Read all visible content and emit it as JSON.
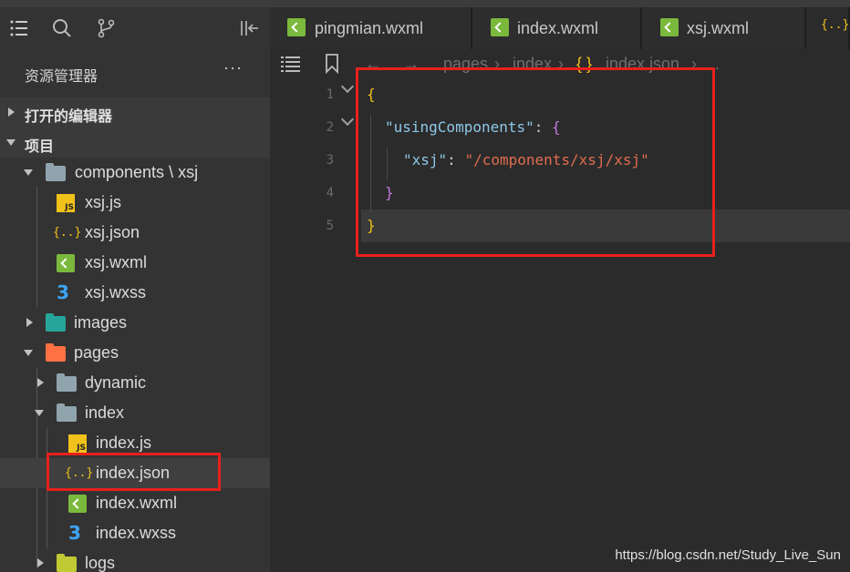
{
  "sidebar": {
    "explorer_title": "资源管理器",
    "more": "···",
    "sections": [
      {
        "label": "打开的编辑器"
      },
      {
        "label": "项目"
      }
    ],
    "tree": [
      {
        "label": "components",
        "suffix": "xsj",
        "kind": "folder"
      },
      {
        "label": "xsj.js",
        "kind": "js"
      },
      {
        "label": "xsj.json",
        "kind": "json"
      },
      {
        "label": "xsj.wxml",
        "kind": "wxml"
      },
      {
        "label": "xsj.wxss",
        "kind": "wxss"
      },
      {
        "label": "images",
        "kind": "folder"
      },
      {
        "label": "pages",
        "kind": "folder"
      },
      {
        "label": "dynamic",
        "kind": "folder"
      },
      {
        "label": "index",
        "kind": "folder"
      },
      {
        "label": "index.js",
        "kind": "js"
      },
      {
        "label": "index.json",
        "kind": "json",
        "selected": true
      },
      {
        "label": "index.wxml",
        "kind": "wxml"
      },
      {
        "label": "index.wxss",
        "kind": "wxss"
      },
      {
        "label": "logs",
        "kind": "folder"
      }
    ],
    "icon_glyphs": {
      "js": "JS",
      "json": "{..}",
      "wxss": "3"
    }
  },
  "tabs": [
    {
      "label": "pingmian.wxml"
    },
    {
      "label": "index.wxml"
    },
    {
      "label": "xsj.wxml"
    },
    {
      "label": "{..}"
    }
  ],
  "breadcrumb": {
    "back": "←",
    "forward": "→",
    "path": [
      "pages",
      "index",
      "index.json",
      "..."
    ],
    "sep": "›",
    "json_glyph": "{ }"
  },
  "code": {
    "line_numbers": [
      "1",
      "2",
      "3",
      "4",
      "5"
    ],
    "lines": [
      [
        "{"
      ],
      [
        "\"usingComponents\"",
        ": ",
        "{"
      ],
      [
        "\"xsj\"",
        ": ",
        "\"/components/xsj/xsj\""
      ],
      [
        "}"
      ],
      [
        "}"
      ]
    ]
  },
  "watermark": "https://blog.csdn.net/Study_Live_Sun",
  "colors": {
    "highlight_box": "#e8201c",
    "json_icon": "#f1c21b",
    "wxml_icon": "#7bb93c",
    "wxss_icon": "#3da5f5"
  }
}
